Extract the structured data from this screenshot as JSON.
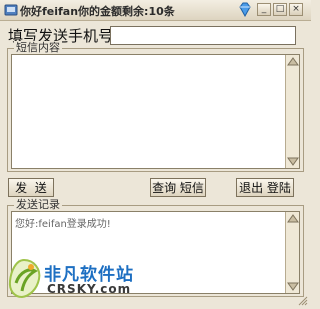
{
  "window": {
    "title": "你好feifan你的金额剩余:10条",
    "minimize_glyph": "_",
    "maximize_glyph": "□",
    "close_glyph": "×"
  },
  "phone": {
    "label": "填写发送手机号:",
    "value": ""
  },
  "sms_group": {
    "label": "短信内容",
    "content": ""
  },
  "buttons": {
    "send": "发  送",
    "query_sms": "查询 短信",
    "logout": "退出 登陆"
  },
  "log_group": {
    "label": "发送记录",
    "text": "您好:feifan登录成功!"
  },
  "watermark": {
    "name": "非凡软件站",
    "domain": "CRSKY.com"
  },
  "colors": {
    "accent": "#1d6fc2",
    "panel": "#ece6d8"
  },
  "icons": [
    "app-icon",
    "gem-icon",
    "minimize-icon",
    "maximize-icon",
    "close-icon",
    "scroll-up-icon",
    "scroll-down-icon",
    "watermark-logo-icon"
  ]
}
